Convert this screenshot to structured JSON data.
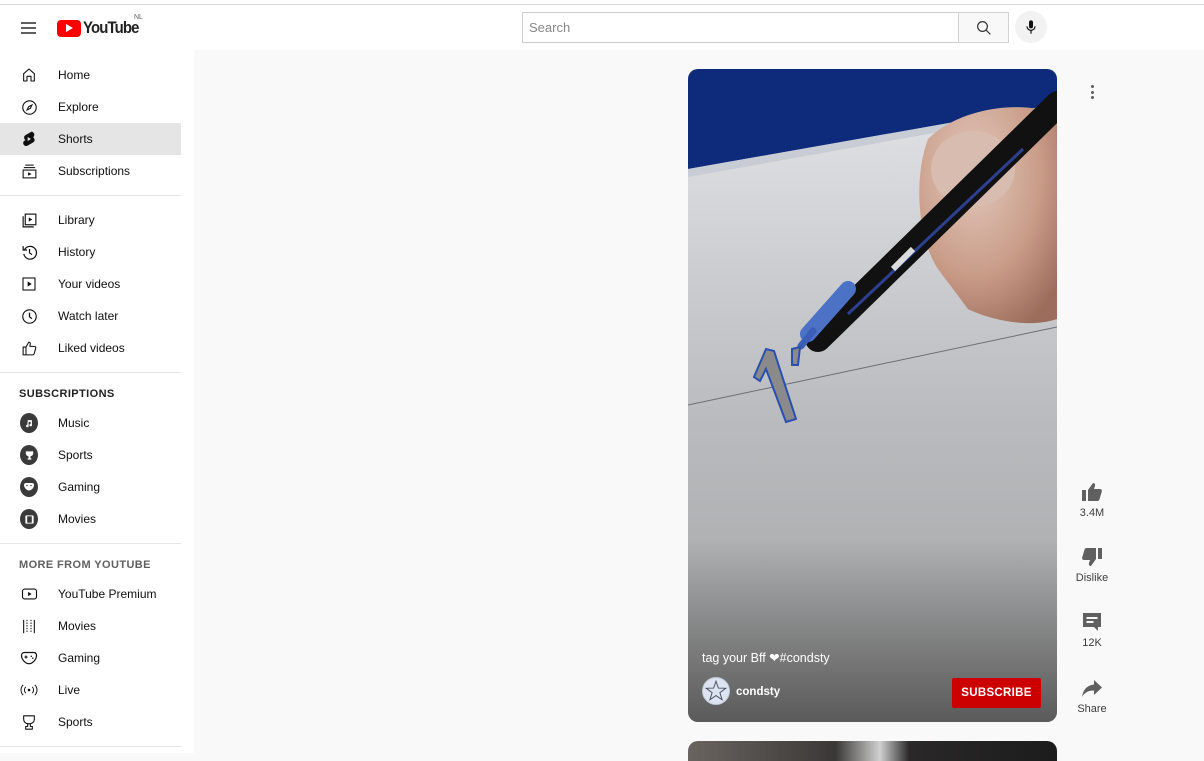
{
  "header": {
    "logo_text": "YouTube",
    "country_code": "NL",
    "search_placeholder": "Search",
    "search_value": ""
  },
  "sidebar": {
    "main": [
      {
        "label": "Home",
        "icon": "home-icon"
      },
      {
        "label": "Explore",
        "icon": "compass-icon"
      },
      {
        "label": "Shorts",
        "icon": "shorts-icon",
        "active": true
      },
      {
        "label": "Subscriptions",
        "icon": "subscriptions-icon"
      }
    ],
    "library": [
      {
        "label": "Library",
        "icon": "library-icon"
      },
      {
        "label": "History",
        "icon": "history-icon"
      },
      {
        "label": "Your videos",
        "icon": "your-videos-icon"
      },
      {
        "label": "Watch later",
        "icon": "clock-icon"
      },
      {
        "label": "Liked videos",
        "icon": "thumbs-up-icon"
      }
    ],
    "subscriptions_title": "SUBSCRIPTIONS",
    "subscriptions": [
      {
        "label": "Music",
        "icon": "music-note-icon"
      },
      {
        "label": "Sports",
        "icon": "trophy-icon"
      },
      {
        "label": "Gaming",
        "icon": "gamepad-icon"
      },
      {
        "label": "Movies",
        "icon": "film-icon"
      }
    ],
    "more_title": "MORE FROM YOUTUBE",
    "more": [
      {
        "label": "YouTube Premium",
        "icon": "youtube-premium-icon"
      },
      {
        "label": "Movies",
        "icon": "film-strip-icon"
      },
      {
        "label": "Gaming",
        "icon": "gamepad-icon"
      },
      {
        "label": "Live",
        "icon": "live-broadcast-icon"
      },
      {
        "label": "Sports",
        "icon": "trophy-icon"
      }
    ]
  },
  "short": {
    "caption": "tag your Bff ❤#condsty",
    "channel": "condsty",
    "subscribe_label": "SUBSCRIBE",
    "accent_color": "#cc0000"
  },
  "actions": {
    "likes": "3.4M",
    "dislike_label": "Dislike",
    "comments": "12K",
    "share_label": "Share"
  }
}
